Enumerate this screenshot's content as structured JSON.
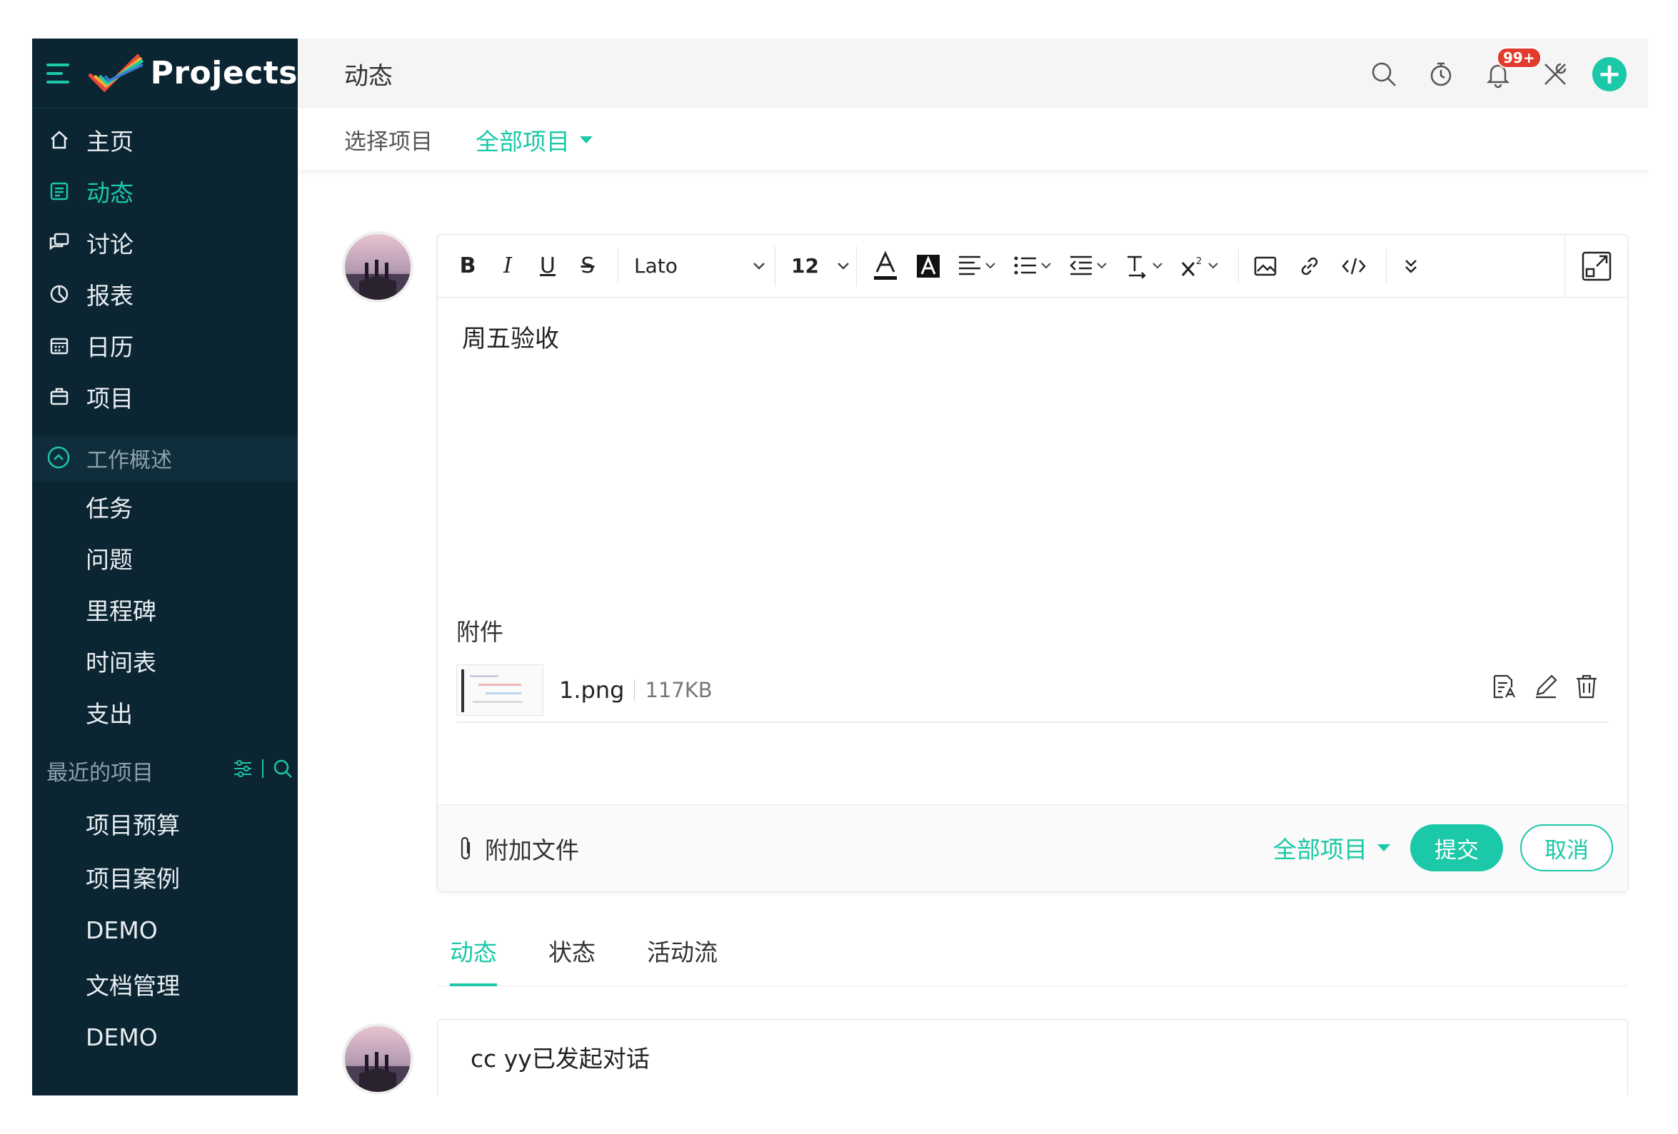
{
  "sidebar": {
    "brand": "Projects",
    "nav": [
      {
        "label": "主页",
        "icon": "home-icon"
      },
      {
        "label": "动态",
        "icon": "feed-icon"
      },
      {
        "label": "讨论",
        "icon": "discussion-icon"
      },
      {
        "label": "报表",
        "icon": "report-icon"
      },
      {
        "label": "日历",
        "icon": "calendar-icon"
      },
      {
        "label": "项目",
        "icon": "briefcase-icon"
      }
    ],
    "work_section": "工作概述",
    "work_items": [
      "任务",
      "问题",
      "里程碑",
      "时间表",
      "支出"
    ],
    "recent_title": "最近的项目",
    "recent_items": [
      "项目预算",
      "项目案例",
      "DEMO",
      "文档管理",
      "DEMO"
    ]
  },
  "topbar": {
    "title": "动态",
    "badge": "99+"
  },
  "filter": {
    "label": "选择项目",
    "value": "全部项目"
  },
  "composer": {
    "font": "Lato",
    "size": "12",
    "content": "周五验收",
    "attachments_title": "附件",
    "file": {
      "name": "1.png",
      "size": "117KB"
    },
    "attach_label": "附加文件",
    "project_select": "全部项目",
    "submit": "提交",
    "cancel": "取消"
  },
  "tabs": [
    "动态",
    "状态",
    "活动流"
  ],
  "activity": {
    "text": "cc yy已发起对话"
  },
  "colors": {
    "accent": "#1bc8a7",
    "sidebar_bg": "#0b2533",
    "badge": "#e23b2e"
  }
}
